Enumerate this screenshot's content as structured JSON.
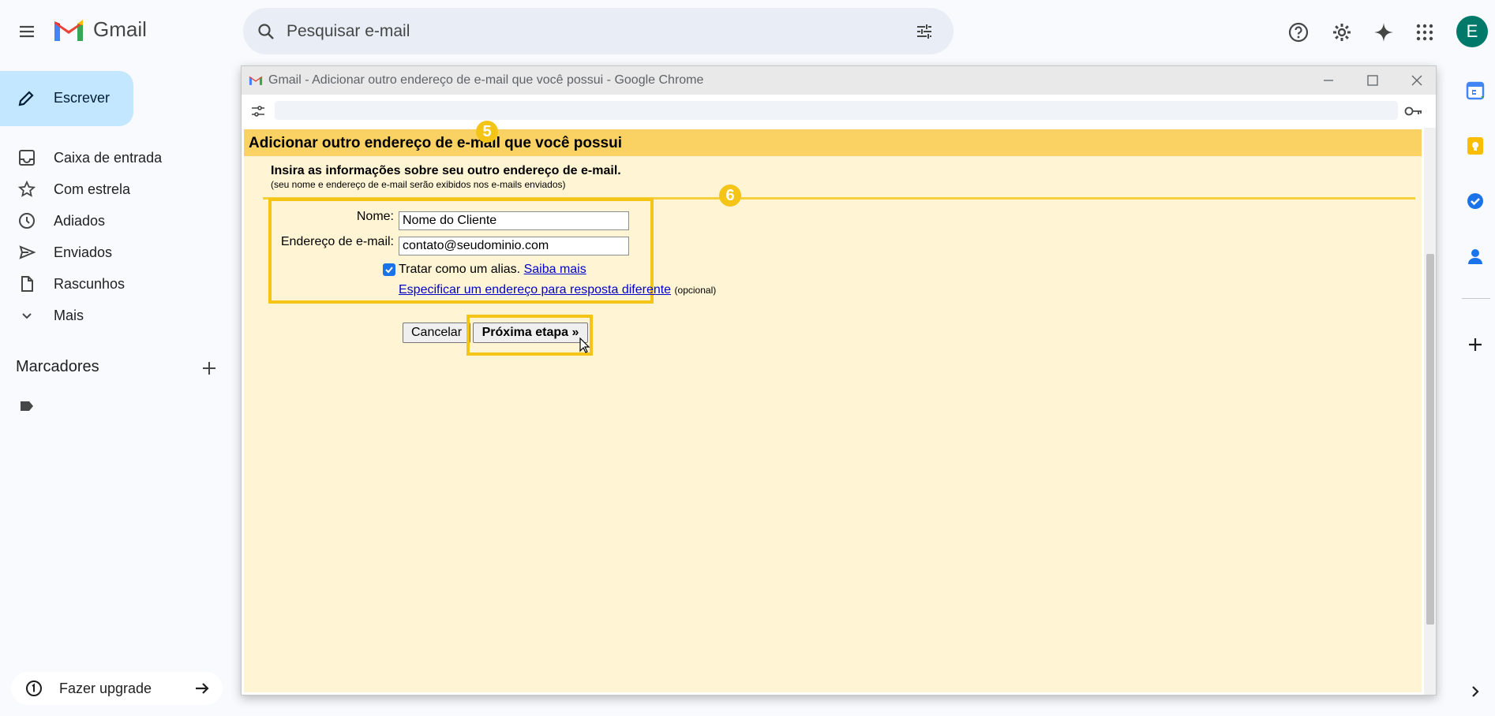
{
  "header": {
    "app_name": "Gmail",
    "search_placeholder": "Pesquisar e-mail",
    "avatar_letter": "E"
  },
  "sidebar": {
    "compose_label": "Escrever",
    "items": [
      {
        "label": "Caixa de entrada",
        "icon": "inbox-icon"
      },
      {
        "label": "Com estrela",
        "icon": "star-icon"
      },
      {
        "label": "Adiados",
        "icon": "clock-icon"
      },
      {
        "label": "Enviados",
        "icon": "send-icon"
      },
      {
        "label": "Rascunhos",
        "icon": "draft-icon"
      },
      {
        "label": "Mais",
        "icon": "chevron-down-icon"
      }
    ],
    "labels_title": "Marcadores",
    "upgrade_label": "Fazer upgrade"
  },
  "popup": {
    "window_title": "Gmail - Adicionar outro endereço de e-mail que você possui - Google Chrome",
    "page_title": "Adicionar outro endereço de e-mail que você possui",
    "intro": "Insira as informações sobre seu outro endereço de e-mail.",
    "intro_sub": "(seu nome e endereço de e-mail serão exibidos nos e-mails enviados)",
    "name_label": "Nome:",
    "name_value": "Nome do Cliente",
    "email_label": "Endereço de e-mail:",
    "email_value": "contato@seudominio.com",
    "alias_label": "Tratar como um alias.",
    "alias_link": "Saiba mais",
    "reply_link": "Especificar um endereço para resposta diferente",
    "reply_optional": "(opcional)",
    "cancel_label": "Cancelar",
    "next_label": "Próxima etapa »",
    "badge_form": "5",
    "badge_next": "6"
  },
  "colors": {
    "page_bg": "#fff5d4",
    "page_header": "#fad163",
    "highlight": "#f4c517",
    "compose_bg": "#c2e7ff",
    "avatar_bg": "#00796b"
  }
}
